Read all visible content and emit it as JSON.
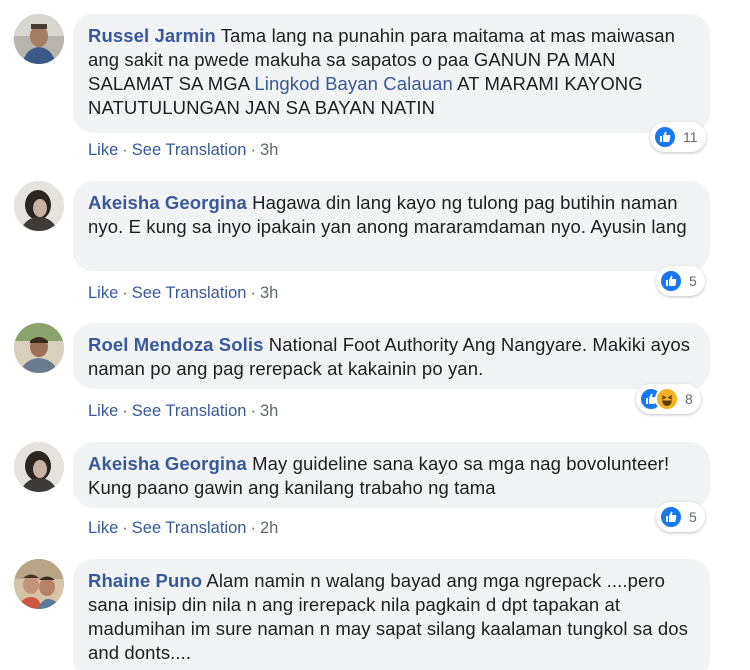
{
  "colors": {
    "link": "#385898",
    "bubble": "#f2f3f5",
    "like_blue": "#1877f2",
    "haha_yellow": "#f7b125",
    "meta_gray": "#606770"
  },
  "actions": {
    "like": "Like",
    "see_translation": "See Translation",
    "sep": "·"
  },
  "comments": [
    {
      "author": "Russel Jarmin",
      "text_before": "Tama lang na punahin para maitama at mas maiwasan ang sakit na pwede makuha sa sapatos o paa GANUN PA MAN SALAMAT SA MGA",
      "tag": "Lingkod Bayan Calauan",
      "text_after": "AT MARAMI KAYONG NATUTULUNGAN JAN SA BAYAN NATIN",
      "time": "3h",
      "reactions": [
        "like-icon"
      ],
      "reaction_count": "11"
    },
    {
      "author": "Akeisha Georgina",
      "text": "Hagawa din lang kayo ng tulong pag butihin naman nyo. E kung sa inyo ipakain yan anong mararamdaman nyo. Ayusin lang",
      "time": "3h",
      "reactions": [
        "like-icon"
      ],
      "reaction_count": "5"
    },
    {
      "author": "Roel Mendoza Solis",
      "text": "National Foot Authority Ang Nangyare. Makiki ayos naman po ang pag rerepack at kakainin po yan.",
      "time": "3h",
      "reactions": [
        "like-icon",
        "haha-icon"
      ],
      "reaction_count": "8"
    },
    {
      "author": "Akeisha Georgina",
      "text": "May guideline sana kayo sa mga nag bovolunteer! Kung paano gawin ang kanilang trabaho ng tama",
      "time": "2h",
      "reactions": [
        "like-icon"
      ],
      "reaction_count": "5"
    },
    {
      "author": "Rhaine Puno",
      "text": "Alam namin n walang bayad ang mga ngrepack ....pero sana inisip din nila n ang irerepack nila pagkain d dpt tapakan at madumihan im sure naman n may sapat silang kaalaman tungkol sa dos and donts...."
    }
  ]
}
